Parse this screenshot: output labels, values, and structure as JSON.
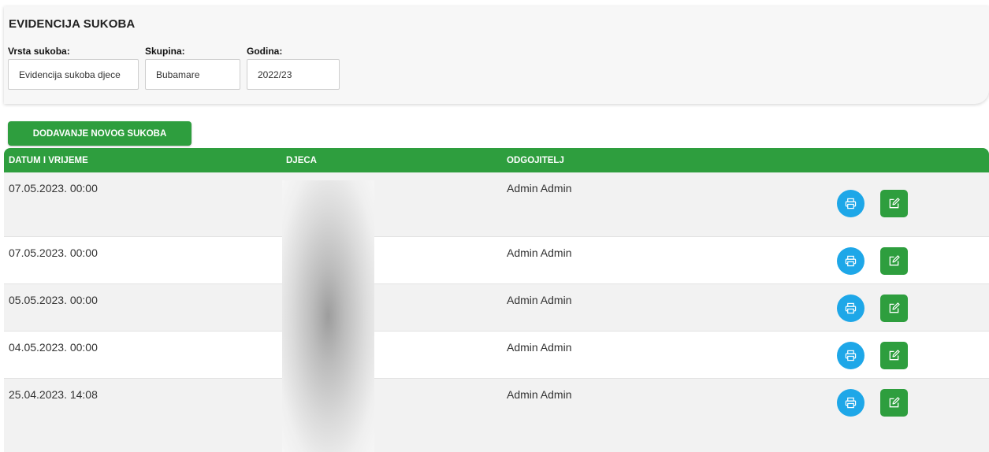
{
  "panel": {
    "title": "EVIDENCIJA SUKOBA",
    "fields": {
      "vrsta": {
        "label": "Vrsta sukoba:",
        "value": "Evidencija sukoba djece"
      },
      "skupina": {
        "label": "Skupina:",
        "value": "Bubamare"
      },
      "godina": {
        "label": "Godina:",
        "value": "2022/23"
      }
    }
  },
  "add_button_label": "DODAVANJE NOVOG SUKOBA",
  "table": {
    "columns": [
      "DATUM I VRIJEME",
      "DJECA",
      "ODGOJITELJ"
    ],
    "rows": [
      {
        "date": "07.05.2023. 00:00",
        "teacher": "Admin Admin"
      },
      {
        "date": "07.05.2023. 00:00",
        "teacher": "Admin Admin"
      },
      {
        "date": "05.05.2023. 00:00",
        "teacher": "Admin Admin"
      },
      {
        "date": "04.05.2023. 00:00",
        "teacher": "Admin Admin"
      },
      {
        "date": "25.04.2023. 14:08",
        "teacher": "Admin Admin"
      }
    ],
    "row_actions": [
      "printer-icon",
      "edit-icon"
    ]
  },
  "colors": {
    "primary_green": "#2e9e3e",
    "print_blue": "#1ea7e8",
    "row_alt": "#f2f2f2"
  }
}
